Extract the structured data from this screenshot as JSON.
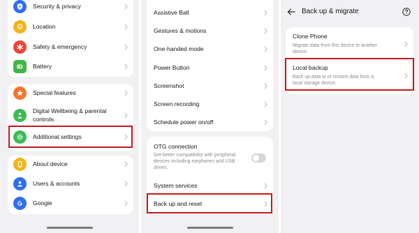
{
  "left_panel": {
    "accent_colors": {
      "security": "#2f6ff0",
      "location": "#f2b51b",
      "safety": "#ef4338",
      "battery": "#41b648",
      "special": "#f2772a",
      "wellbeing": "#3dbb54",
      "additional": "#3dbb54",
      "about": "#f2b51b",
      "users": "#2f6ff0",
      "google": "#2f6ff0"
    },
    "group1": [
      {
        "label": "Security & privacy",
        "icon": "shield-icon"
      },
      {
        "label": "Location",
        "icon": "location-pin-icon"
      },
      {
        "label": "Safety & emergency",
        "icon": "asterisk-icon"
      },
      {
        "label": "Battery",
        "icon": "battery-icon"
      }
    ],
    "group2": [
      {
        "label": "Special features",
        "icon": "star-icon"
      },
      {
        "label_line1": "Digital Wellbeing & parental",
        "label_line2": "controls",
        "icon": "person-icon"
      },
      {
        "label": "Additional settings",
        "icon": "gear-icon"
      }
    ],
    "group3": [
      {
        "label": "About device",
        "icon": "phone-icon"
      },
      {
        "label": "Users & accounts",
        "icon": "user-icon"
      },
      {
        "label": "Google",
        "icon": "google-icon"
      }
    ]
  },
  "middle_panel": {
    "group1": [
      {
        "label": "Assistive Ball"
      },
      {
        "label": "Gestures & motions"
      },
      {
        "label": "One-handed mode"
      },
      {
        "label": "Power Button"
      },
      {
        "label": "Screenshot"
      },
      {
        "label": "Screen recording"
      },
      {
        "label": "Schedule power on/off"
      }
    ],
    "otg": {
      "label": "OTG connection",
      "desc_line1": "Get better compatibility with peripheral",
      "desc_line2": "devices including earphones and USB",
      "desc_line3": "drives.",
      "toggle_on": false
    },
    "group2": [
      {
        "label": "System services"
      },
      {
        "label": "Back up and reset"
      }
    ]
  },
  "right_panel": {
    "title": "Back up & migrate",
    "items": [
      {
        "label": "Clone Phone",
        "desc_line1": "Migrate data from this device to another",
        "desc_line2": "device."
      },
      {
        "label": "Local backup",
        "desc_line1": "Back up data to or restore data from a",
        "desc_line2": "local storage device."
      }
    ]
  },
  "highlight_color": "#c8161a"
}
